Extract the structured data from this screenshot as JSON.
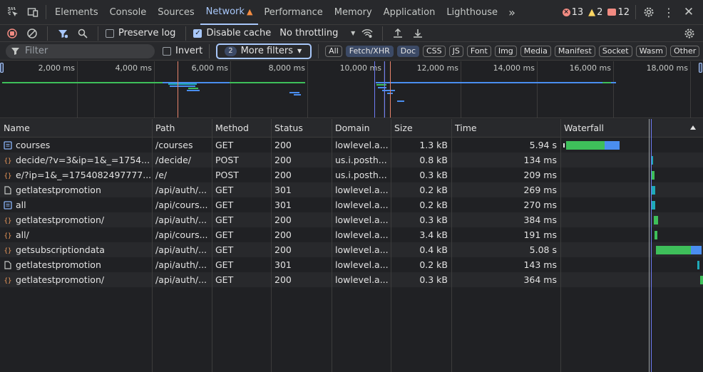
{
  "tabs": [
    {
      "label": "Elements"
    },
    {
      "label": "Console"
    },
    {
      "label": "Sources"
    },
    {
      "label": "Network",
      "warning": true,
      "active": true
    },
    {
      "label": "Performance"
    },
    {
      "label": "Memory"
    },
    {
      "label": "Application"
    },
    {
      "label": "Lighthouse"
    }
  ],
  "counts": {
    "errors": "13",
    "warnings": "2",
    "issues": "12"
  },
  "toolbar": {
    "preserve_log": "Preserve log",
    "preserve_log_checked": false,
    "disable_cache": "Disable cache",
    "disable_cache_checked": true,
    "throttling": "No throttling"
  },
  "filterbar": {
    "placeholder": "Filter",
    "invert": "Invert",
    "more_filters_count": "2",
    "more_filters": "More filters",
    "types": [
      {
        "label": "All",
        "active": false
      },
      {
        "label": "Fetch/XHR",
        "active": true
      },
      {
        "label": "Doc",
        "active": true
      },
      {
        "label": "CSS",
        "active": false
      },
      {
        "label": "JS",
        "active": false
      },
      {
        "label": "Font",
        "active": false
      },
      {
        "label": "Img",
        "active": false
      },
      {
        "label": "Media",
        "active": false
      },
      {
        "label": "Manifest",
        "active": false
      },
      {
        "label": "Socket",
        "active": false
      },
      {
        "label": "Wasm",
        "active": false
      },
      {
        "label": "Other",
        "active": false
      }
    ]
  },
  "overview": {
    "ticks": [
      "2,000 ms",
      "4,000 ms",
      "6,000 ms",
      "8,000 ms",
      "10,000 ms",
      "12,000 ms",
      "14,000 ms",
      "16,000 ms",
      "18,000 ms"
    ]
  },
  "columns": [
    "Name",
    "Path",
    "Method",
    "Status",
    "Domain",
    "Size",
    "Time",
    "Waterfall"
  ],
  "rows": [
    {
      "type": "doc",
      "name": "courses",
      "path": "/courses",
      "method": "GET",
      "status": "200",
      "domain": "lowlevel.a...",
      "size": "1.3 kB",
      "time": "5.94 s"
    },
    {
      "type": "xhr",
      "name": "decide/?v=3&ip=1&_=1754...",
      "path": "/decide/",
      "method": "POST",
      "status": "200",
      "domain": "us.i.posth...",
      "size": "0.8 kB",
      "time": "134 ms"
    },
    {
      "type": "xhr",
      "name": "e/?ip=1&_=1754082497777...",
      "path": "/e/",
      "method": "POST",
      "status": "200",
      "domain": "us.i.posth...",
      "size": "0.3 kB",
      "time": "209 ms"
    },
    {
      "type": "other",
      "name": "getlatestpromotion",
      "path": "/api/auth/...",
      "method": "GET",
      "status": "301",
      "domain": "lowlevel.a...",
      "size": "0.2 kB",
      "time": "269 ms"
    },
    {
      "type": "doc",
      "name": "all",
      "path": "/api/cours...",
      "method": "GET",
      "status": "301",
      "domain": "lowlevel.a...",
      "size": "0.2 kB",
      "time": "270 ms"
    },
    {
      "type": "xhr",
      "name": "getlatestpromotion/",
      "path": "/api/auth/...",
      "method": "GET",
      "status": "200",
      "domain": "lowlevel.a...",
      "size": "0.3 kB",
      "time": "384 ms"
    },
    {
      "type": "xhr",
      "name": "all/",
      "path": "/api/cours...",
      "method": "GET",
      "status": "200",
      "domain": "lowlevel.a...",
      "size": "3.4 kB",
      "time": "191 ms"
    },
    {
      "type": "xhr",
      "name": "getsubscriptiondata",
      "path": "/api/auth/...",
      "method": "GET",
      "status": "200",
      "domain": "lowlevel.a...",
      "size": "0.4 kB",
      "time": "5.08 s"
    },
    {
      "type": "other",
      "name": "getlatestpromotion",
      "path": "/api/auth/...",
      "method": "GET",
      "status": "301",
      "domain": "lowlevel.a...",
      "size": "0.2 kB",
      "time": "143 ms"
    },
    {
      "type": "xhr",
      "name": "getlatestpromotion/",
      "path": "/api/auth/...",
      "method": "GET",
      "status": "200",
      "domain": "lowlevel.a...",
      "size": "0.3 kB",
      "time": "364 ms"
    }
  ],
  "colors": {
    "accent": "#a8c7fa",
    "waiting": "#3ebf5a",
    "download": "#4a8ef0",
    "connect": "#1fa9b8",
    "dom_loaded": "#6e7cf5",
    "load": "#e8836b"
  }
}
